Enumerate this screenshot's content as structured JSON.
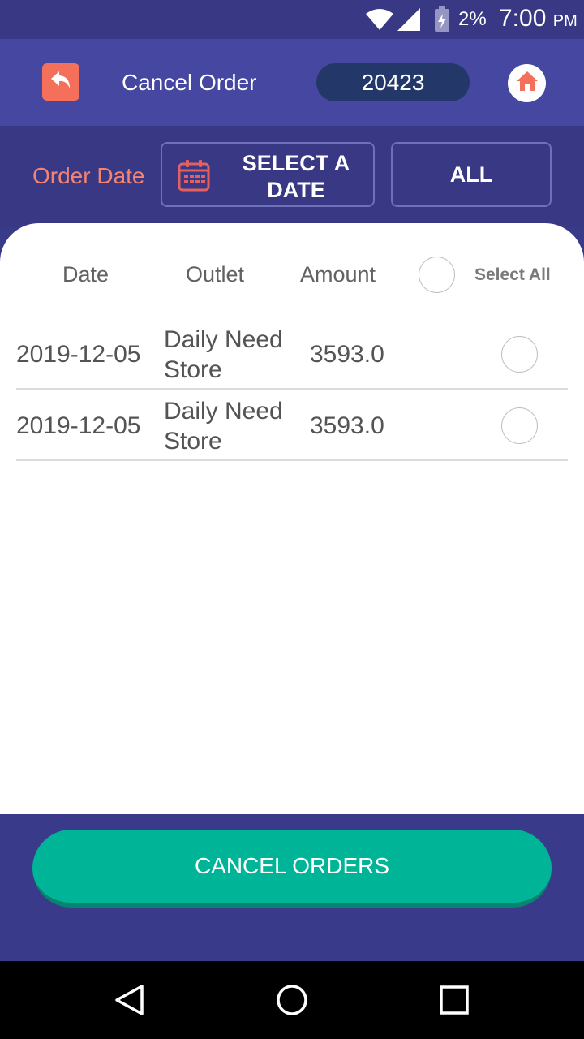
{
  "status_bar": {
    "battery_pct": "2%",
    "time": "7:00",
    "ampm": "PM"
  },
  "header": {
    "title": "Cancel Order",
    "order_id": "20423"
  },
  "filter": {
    "label": "Order Date",
    "date_button": "SELECT A DATE",
    "all_button": "ALL"
  },
  "table": {
    "headers": {
      "date": "Date",
      "outlet": "Outlet",
      "amount": "Amount",
      "select_all": "Select All"
    },
    "rows": [
      {
        "date": "2019-12-05",
        "outlet_line1": "Daily Need",
        "outlet_line2": "Store",
        "amount": "3593.0"
      },
      {
        "date": "2019-12-05",
        "outlet_line1": "Daily Need",
        "outlet_line2": "Store",
        "amount": "3593.0"
      }
    ]
  },
  "footer": {
    "cancel_button": "CANCEL ORDERS"
  },
  "colors": {
    "accent": "#f4705a",
    "primary": "#383885",
    "header": "#4547a0",
    "pill": "#233868",
    "button": "#00b497"
  }
}
